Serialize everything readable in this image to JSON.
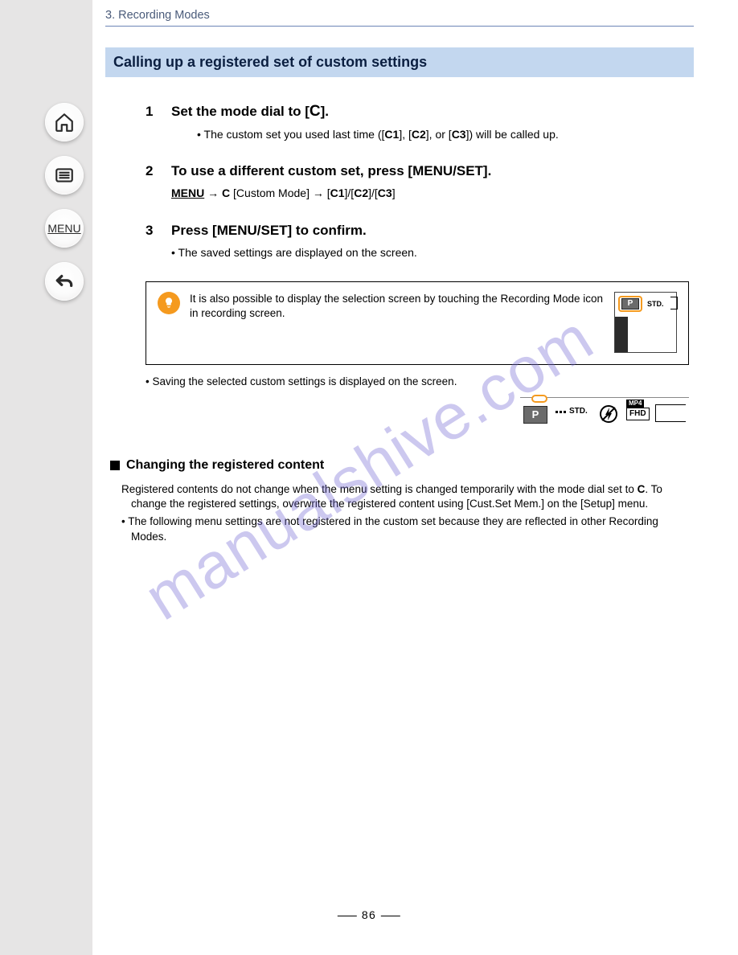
{
  "page_number": "86",
  "chapter": "3. Recording Modes",
  "section_title": "Calling up a registered set of custom settings",
  "watermark": "manualshive.com",
  "nav": {
    "home_label": "Home",
    "contents_label": "Contents",
    "menu_label": "MENU",
    "back_label": "Back"
  },
  "steps": {
    "s1": {
      "num": "1",
      "head_pre": "Set the mode dial to [",
      "head_glyph": "C",
      "head_post": "].",
      "body": "• The custom set you used last time ([     ], [     ], or [     ]) will be called up."
    },
    "s2": {
      "num": "2",
      "head_pre": "To use a different custom set, press [MENU/SET].",
      "body_lines": [
        "> [Custom Mode] > [",
        "1]/[",
        "2]/[",
        "3]"
      ],
      "menu_label": "MENU"
    },
    "s3": {
      "num": "3",
      "head": "Press [MENU/SET] to confirm.",
      "body": "• The saved settings are displayed on the screen."
    }
  },
  "tip": {
    "text": "It is also possible to display the selection screen by touching the Recording Mode icon in recording screen."
  },
  "note": "• Saving the selected custom settings is displayed on the screen.",
  "strip": {
    "p_label": "P",
    "std_label": "STD.",
    "fhd_label": "FHD",
    "mp4_label": "MP4"
  },
  "thumb": {
    "p_label": "P",
    "std_label": "STD."
  },
  "subsection": {
    "title_pre": "Changing the registered content",
    "line1_pre": "Registered contents do not change when the menu setting is changed temporarily with the mode dial set to ",
    "line1_glyph": "C",
    "line1_post": ". To change the registered settings, overwrite the registered content using [Cust.Set Mem.] on the [Setup] menu.",
    "line2": "• The following menu settings are not registered in the custom set because they are reflected in other Recording Modes."
  }
}
